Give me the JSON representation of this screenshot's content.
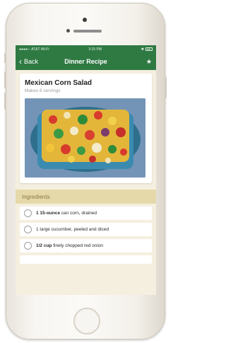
{
  "status_bar": {
    "carrier": "AT&T Wi-Fi",
    "time": "3:15 PM",
    "battery_icon": "battery-icon"
  },
  "nav": {
    "back_label": "Back",
    "title": "Dinner Recipe",
    "star_icon": "star-icon"
  },
  "recipe": {
    "title": "Mexican Corn Salad",
    "servings": "Makes 6 servings"
  },
  "ingredients": {
    "header": "Ingredients",
    "items": [
      {
        "qty": "1 15-ounce",
        "text": " can corn, drained"
      },
      {
        "qty": "",
        "text": "1 large cucumber, peeled and diced"
      },
      {
        "qty": "1/2 cup",
        "text": " finely chopped red onion"
      }
    ]
  },
  "colors": {
    "header_green": "#2f7a43",
    "ingredients_band": "#e6d9a9",
    "screen_background": "#f5efdf"
  }
}
